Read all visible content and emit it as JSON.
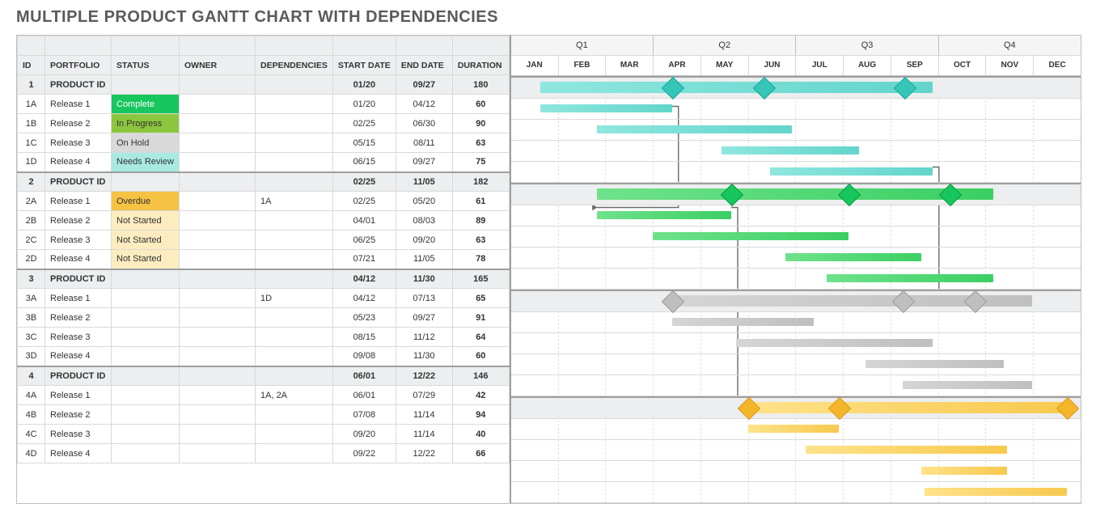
{
  "title": "MULTIPLE PRODUCT GANTT CHART WITH DEPENDENCIES",
  "headers": {
    "id": "ID",
    "portfolio": "PORTFOLIO",
    "status": "STATUS",
    "owner": "OWNER",
    "dep": "DEPENDENCIES",
    "start": "START DATE",
    "end": "END DATE",
    "dur": "DURATION"
  },
  "quarters": [
    "Q1",
    "Q2",
    "Q3",
    "Q4"
  ],
  "months": [
    "JAN",
    "FEB",
    "MAR",
    "APR",
    "MAY",
    "JUN",
    "JUL",
    "AUG",
    "SEP",
    "OCT",
    "NOV",
    "DEC"
  ],
  "status_labels": {
    "complete": "Complete",
    "progress": "In Progress",
    "hold": "On Hold",
    "review": "Needs Review",
    "overdue": "Overdue",
    "nostart": "Not Started"
  },
  "colors": {
    "p1": {
      "bar": "linear-gradient(90deg,#8fe7df,#62d5cb)",
      "dia": "#35c6b8",
      "border": "#1aa899"
    },
    "p2": {
      "bar": "linear-gradient(90deg,#6fe28b,#3bcf63)",
      "dia": "#17c65c",
      "border": "#0f9a45"
    },
    "p3": {
      "bar": "linear-gradient(90deg,#d5d5d5,#bfbfbf)",
      "dia": "#bfbfbf",
      "border": "#9b9b9b"
    },
    "p4": {
      "bar": "linear-gradient(90deg,#ffe28a,#f7c94e)",
      "dia": "#f5b52a",
      "border": "#d8991a"
    }
  },
  "rows": [
    {
      "id": "1",
      "portfolio": "PRODUCT ID",
      "status": "",
      "owner": "",
      "dep": "",
      "start": "01/20",
      "end": "09/27",
      "dur": "180",
      "prod": true,
      "pal": "p1",
      "bar": [
        19,
        270
      ],
      "milestones": [
        103,
        162,
        252
      ]
    },
    {
      "id": "1A",
      "portfolio": "Release 1",
      "status": "complete",
      "owner": "",
      "dep": "",
      "start": "01/20",
      "end": "04/12",
      "dur": "60",
      "pal": "p1",
      "bar": [
        19,
        103
      ]
    },
    {
      "id": "1B",
      "portfolio": "Release 2",
      "status": "progress",
      "owner": "",
      "dep": "",
      "start": "02/25",
      "end": "06/30",
      "dur": "90",
      "pal": "p1",
      "bar": [
        55,
        180
      ]
    },
    {
      "id": "1C",
      "portfolio": "Release 3",
      "status": "hold",
      "owner": "",
      "dep": "",
      "start": "05/15",
      "end": "08/11",
      "dur": "63",
      "pal": "p1",
      "bar": [
        135,
        223
      ]
    },
    {
      "id": "1D",
      "portfolio": "Release 4",
      "status": "review",
      "owner": "",
      "dep": "",
      "start": "06/15",
      "end": "09/27",
      "dur": "75",
      "pal": "p1",
      "bar": [
        166,
        270
      ]
    },
    {
      "id": "2",
      "portfolio": "PRODUCT ID",
      "status": "",
      "owner": "",
      "dep": "",
      "start": "02/25",
      "end": "11/05",
      "dur": "182",
      "prod": true,
      "pal": "p2",
      "bar": [
        55,
        309
      ],
      "milestones": [
        141,
        216,
        281
      ]
    },
    {
      "id": "2A",
      "portfolio": "Release 1",
      "status": "overdue",
      "owner": "",
      "dep": "1A",
      "start": "02/25",
      "end": "05/20",
      "dur": "61",
      "pal": "p2",
      "bar": [
        55,
        141
      ]
    },
    {
      "id": "2B",
      "portfolio": "Release 2",
      "status": "nostart",
      "owner": "",
      "dep": "",
      "start": "04/01",
      "end": "08/03",
      "dur": "89",
      "pal": "p2",
      "bar": [
        91,
        216
      ]
    },
    {
      "id": "2C",
      "portfolio": "Release 3",
      "status": "nostart",
      "owner": "",
      "dep": "",
      "start": "06/25",
      "end": "09/20",
      "dur": "63",
      "pal": "p2",
      "bar": [
        176,
        263
      ]
    },
    {
      "id": "2D",
      "portfolio": "Release 4",
      "status": "nostart",
      "owner": "",
      "dep": "",
      "start": "07/21",
      "end": "11/05",
      "dur": "78",
      "pal": "p2",
      "bar": [
        202,
        309
      ]
    },
    {
      "id": "3",
      "portfolio": "PRODUCT ID",
      "status": "",
      "owner": "",
      "dep": "",
      "start": "04/12",
      "end": "11/30",
      "dur": "165",
      "prod": true,
      "pal": "p3",
      "bar": [
        103,
        334
      ],
      "milestones": [
        103,
        251,
        297
      ]
    },
    {
      "id": "3A",
      "portfolio": "Release 1",
      "status": "",
      "owner": "",
      "dep": "1D",
      "start": "04/12",
      "end": "07/13",
      "dur": "65",
      "pal": "p3",
      "bar": [
        103,
        194
      ]
    },
    {
      "id": "3B",
      "portfolio": "Release 2",
      "status": "",
      "owner": "",
      "dep": "",
      "start": "05/23",
      "end": "09/27",
      "dur": "91",
      "pal": "p3",
      "bar": [
        144,
        270
      ]
    },
    {
      "id": "3C",
      "portfolio": "Release 3",
      "status": "",
      "owner": "",
      "dep": "",
      "start": "08/15",
      "end": "11/12",
      "dur": "64",
      "pal": "p3",
      "bar": [
        227,
        316
      ]
    },
    {
      "id": "3D",
      "portfolio": "Release 4",
      "status": "",
      "owner": "",
      "dep": "",
      "start": "09/08",
      "end": "11/30",
      "dur": "60",
      "pal": "p3",
      "bar": [
        251,
        334
      ]
    },
    {
      "id": "4",
      "portfolio": "PRODUCT ID",
      "status": "",
      "owner": "",
      "dep": "",
      "start": "06/01",
      "end": "12/22",
      "dur": "146",
      "prod": true,
      "pal": "p4",
      "bar": [
        152,
        356
      ],
      "milestones": [
        152,
        210,
        356
      ]
    },
    {
      "id": "4A",
      "portfolio": "Release 1",
      "status": "",
      "owner": "",
      "dep": "1A, 2A",
      "start": "06/01",
      "end": "07/29",
      "dur": "42",
      "pal": "p4",
      "bar": [
        152,
        210
      ]
    },
    {
      "id": "4B",
      "portfolio": "Release 2",
      "status": "",
      "owner": "",
      "dep": "",
      "start": "07/08",
      "end": "11/14",
      "dur": "94",
      "pal": "p4",
      "bar": [
        189,
        318
      ]
    },
    {
      "id": "4C",
      "portfolio": "Release 3",
      "status": "",
      "owner": "",
      "dep": "",
      "start": "09/20",
      "end": "11/14",
      "dur": "40",
      "pal": "p4",
      "bar": [
        263,
        318
      ]
    },
    {
      "id": "4D",
      "portfolio": "Release 4",
      "status": "",
      "owner": "",
      "dep": "",
      "start": "09/22",
      "end": "12/22",
      "dur": "66",
      "pal": "p4",
      "bar": [
        265,
        356
      ]
    }
  ],
  "dependencies": [
    {
      "from": "1A",
      "to": "2A"
    },
    {
      "from": "1D",
      "to": "3A"
    },
    {
      "from": "2A",
      "to": "4A"
    }
  ],
  "chart_data": {
    "type": "gantt",
    "time_axis": {
      "start": "01/01",
      "end": "12/31",
      "divisions": "months",
      "labels": [
        "JAN",
        "FEB",
        "MAR",
        "APR",
        "MAY",
        "JUN",
        "JUL",
        "AUG",
        "SEP",
        "OCT",
        "NOV",
        "DEC"
      ],
      "group_labels": [
        "Q1",
        "Q2",
        "Q3",
        "Q4"
      ]
    },
    "rows": [
      {
        "id": "1",
        "label": "PRODUCT ID",
        "start": "01/20",
        "end": "09/27",
        "duration": 180,
        "group": true,
        "milestones": [
          "04/12",
          "06/15",
          "09/27"
        ]
      },
      {
        "id": "1A",
        "label": "Release 1",
        "start": "01/20",
        "end": "04/12",
        "duration": 60,
        "status": "Complete"
      },
      {
        "id": "1B",
        "label": "Release 2",
        "start": "02/25",
        "end": "06/30",
        "duration": 90,
        "status": "In Progress"
      },
      {
        "id": "1C",
        "label": "Release 3",
        "start": "05/15",
        "end": "08/11",
        "duration": 63,
        "status": "On Hold"
      },
      {
        "id": "1D",
        "label": "Release 4",
        "start": "06/15",
        "end": "09/27",
        "duration": 75,
        "status": "Needs Review"
      },
      {
        "id": "2",
        "label": "PRODUCT ID",
        "start": "02/25",
        "end": "11/05",
        "duration": 182,
        "group": true,
        "milestones": [
          "05/20",
          "08/03",
          "10/08"
        ]
      },
      {
        "id": "2A",
        "label": "Release 1",
        "start": "02/25",
        "end": "05/20",
        "duration": 61,
        "status": "Overdue",
        "depends_on": [
          "1A"
        ]
      },
      {
        "id": "2B",
        "label": "Release 2",
        "start": "04/01",
        "end": "08/03",
        "duration": 89,
        "status": "Not Started"
      },
      {
        "id": "2C",
        "label": "Release 3",
        "start": "06/25",
        "end": "09/20",
        "duration": 63,
        "status": "Not Started"
      },
      {
        "id": "2D",
        "label": "Release 4",
        "start": "07/21",
        "end": "11/05",
        "duration": 78,
        "status": "Not Started"
      },
      {
        "id": "3",
        "label": "PRODUCT ID",
        "start": "04/12",
        "end": "11/30",
        "duration": 165,
        "group": true,
        "milestones": [
          "04/12",
          "09/08",
          "10/25"
        ]
      },
      {
        "id": "3A",
        "label": "Release 1",
        "start": "04/12",
        "end": "07/13",
        "duration": 65,
        "depends_on": [
          "1D"
        ]
      },
      {
        "id": "3B",
        "label": "Release 2",
        "start": "05/23",
        "end": "09/27",
        "duration": 91
      },
      {
        "id": "3C",
        "label": "Release 3",
        "start": "08/15",
        "end": "11/12",
        "duration": 64
      },
      {
        "id": "3D",
        "label": "Release 4",
        "start": "09/08",
        "end": "11/30",
        "duration": 60
      },
      {
        "id": "4",
        "label": "PRODUCT ID",
        "start": "06/01",
        "end": "12/22",
        "duration": 146,
        "group": true,
        "milestones": [
          "06/01",
          "07/29",
          "12/22"
        ]
      },
      {
        "id": "4A",
        "label": "Release 1",
        "start": "06/01",
        "end": "07/29",
        "duration": 42,
        "depends_on": [
          "1A",
          "2A"
        ]
      },
      {
        "id": "4B",
        "label": "Release 2",
        "start": "07/08",
        "end": "11/14",
        "duration": 94
      },
      {
        "id": "4C",
        "label": "Release 3",
        "start": "09/20",
        "end": "11/14",
        "duration": 40
      },
      {
        "id": "4D",
        "label": "Release 4",
        "start": "09/22",
        "end": "12/22",
        "duration": 66
      }
    ]
  }
}
